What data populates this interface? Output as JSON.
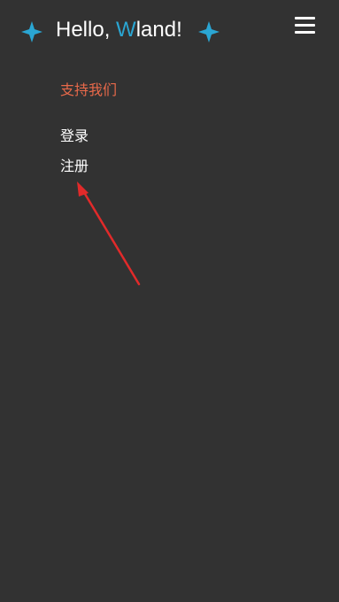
{
  "header": {
    "title_prefix": "Hello, ",
    "title_accent": "W",
    "title_suffix": "land!",
    "left_icon": "sparkle-icon",
    "right_icon": "sparkle-icon",
    "menu_icon": "hamburger-menu-icon"
  },
  "nav": {
    "support_label": "支持我们",
    "login_label": "登录",
    "register_label": "注册"
  },
  "colors": {
    "background": "#323232",
    "accent": "#2aa6d3",
    "support_link": "#e8694a",
    "annotation_arrow": "#e12a2a"
  }
}
